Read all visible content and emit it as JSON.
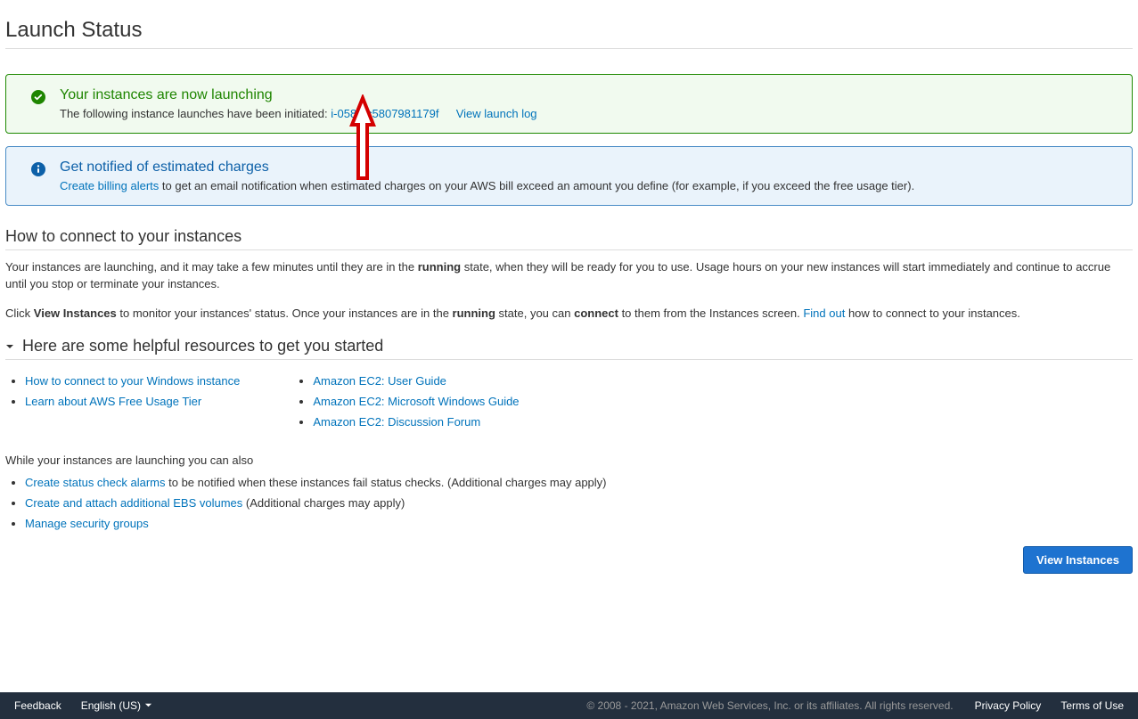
{
  "page_title": "Launch Status",
  "success_alert": {
    "title": "Your instances are now launching",
    "body_prefix": "The following instance launches have been initiated: ",
    "instance_id": "i-0588fc5807981179f",
    "view_log": "View launch log"
  },
  "info_alert": {
    "title": "Get notified of estimated charges",
    "link": "Create billing alerts",
    "body_suffix": " to get an email notification when estimated charges on your AWS bill exceed an amount you define (for example, if you exceed the free usage tier)."
  },
  "connect_section": {
    "title": "How to connect to your instances",
    "para1_a": "Your instances are launching, and it may take a few minutes until they are in the ",
    "para1_b": "running",
    "para1_c": " state, when they will be ready for you to use. Usage hours on your new instances will start immediately and continue to accrue until you stop or terminate your instances.",
    "para2_a": "Click ",
    "para2_b": "View Instances",
    "para2_c": " to monitor your instances' status. Once your instances are in the ",
    "para2_d": "running",
    "para2_e": " state, you can ",
    "para2_f": "connect",
    "para2_g": " to them from the Instances screen. ",
    "find_out": "Find out",
    "para2_h": " how to connect to your instances."
  },
  "resources": {
    "header": "Here are some helpful resources to get you started",
    "col1": [
      "How to connect to your Windows instance",
      "Learn about AWS Free Usage Tier"
    ],
    "col2": [
      "Amazon EC2: User Guide",
      "Amazon EC2: Microsoft Windows Guide",
      "Amazon EC2: Discussion Forum"
    ]
  },
  "while_launching": {
    "intro": "While your instances are launching you can also",
    "items": [
      {
        "link": "Create status check alarms",
        "tail": " to be notified when these instances fail status checks. (Additional charges may apply)"
      },
      {
        "link": "Create and attach additional EBS volumes",
        "tail": " (Additional charges may apply)"
      },
      {
        "link": "Manage security groups",
        "tail": ""
      }
    ]
  },
  "view_instances_btn": "View Instances",
  "footer": {
    "feedback": "Feedback",
    "language": "English (US)",
    "legal": "© 2008 - 2021, Amazon Web Services, Inc. or its affiliates. All rights reserved.",
    "privacy": "Privacy Policy",
    "terms": "Terms of Use"
  }
}
